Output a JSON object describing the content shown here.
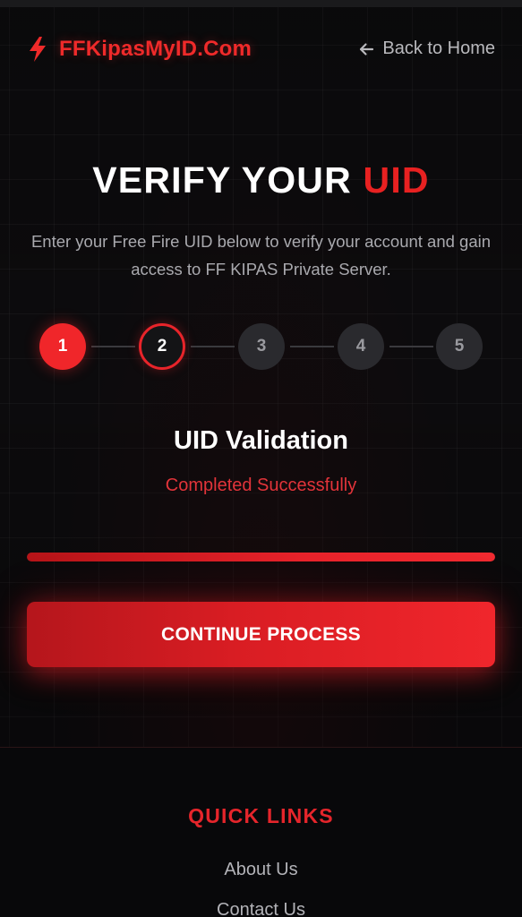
{
  "header": {
    "brand_name": "FFKipasMyID.Com",
    "brand_icon": "bolt-icon",
    "back_link": "Back to Home",
    "back_icon": "arrow-left-icon"
  },
  "hero": {
    "title_main": "VERIFY YOUR ",
    "title_accent": "UID",
    "subtitle": "Enter your Free Fire UID below to verify your account and gain access to FF KIPAS Private Server."
  },
  "stepper": {
    "steps": [
      {
        "label": "1",
        "state": "done"
      },
      {
        "label": "2",
        "state": "active"
      },
      {
        "label": "3",
        "state": "pending"
      },
      {
        "label": "4",
        "state": "pending"
      },
      {
        "label": "5",
        "state": "pending"
      }
    ]
  },
  "status": {
    "title": "UID Validation",
    "message": "Completed Successfully"
  },
  "progress": {
    "percent": 100
  },
  "actions": {
    "continue_label": "CONTINUE PROCESS"
  },
  "footer": {
    "heading": "QUICK LINKS",
    "links": [
      "About Us",
      "Contact Us"
    ]
  },
  "colors": {
    "accent": "#e82121",
    "background": "#0b0b0d",
    "step_pending": "#2a2a2e"
  }
}
